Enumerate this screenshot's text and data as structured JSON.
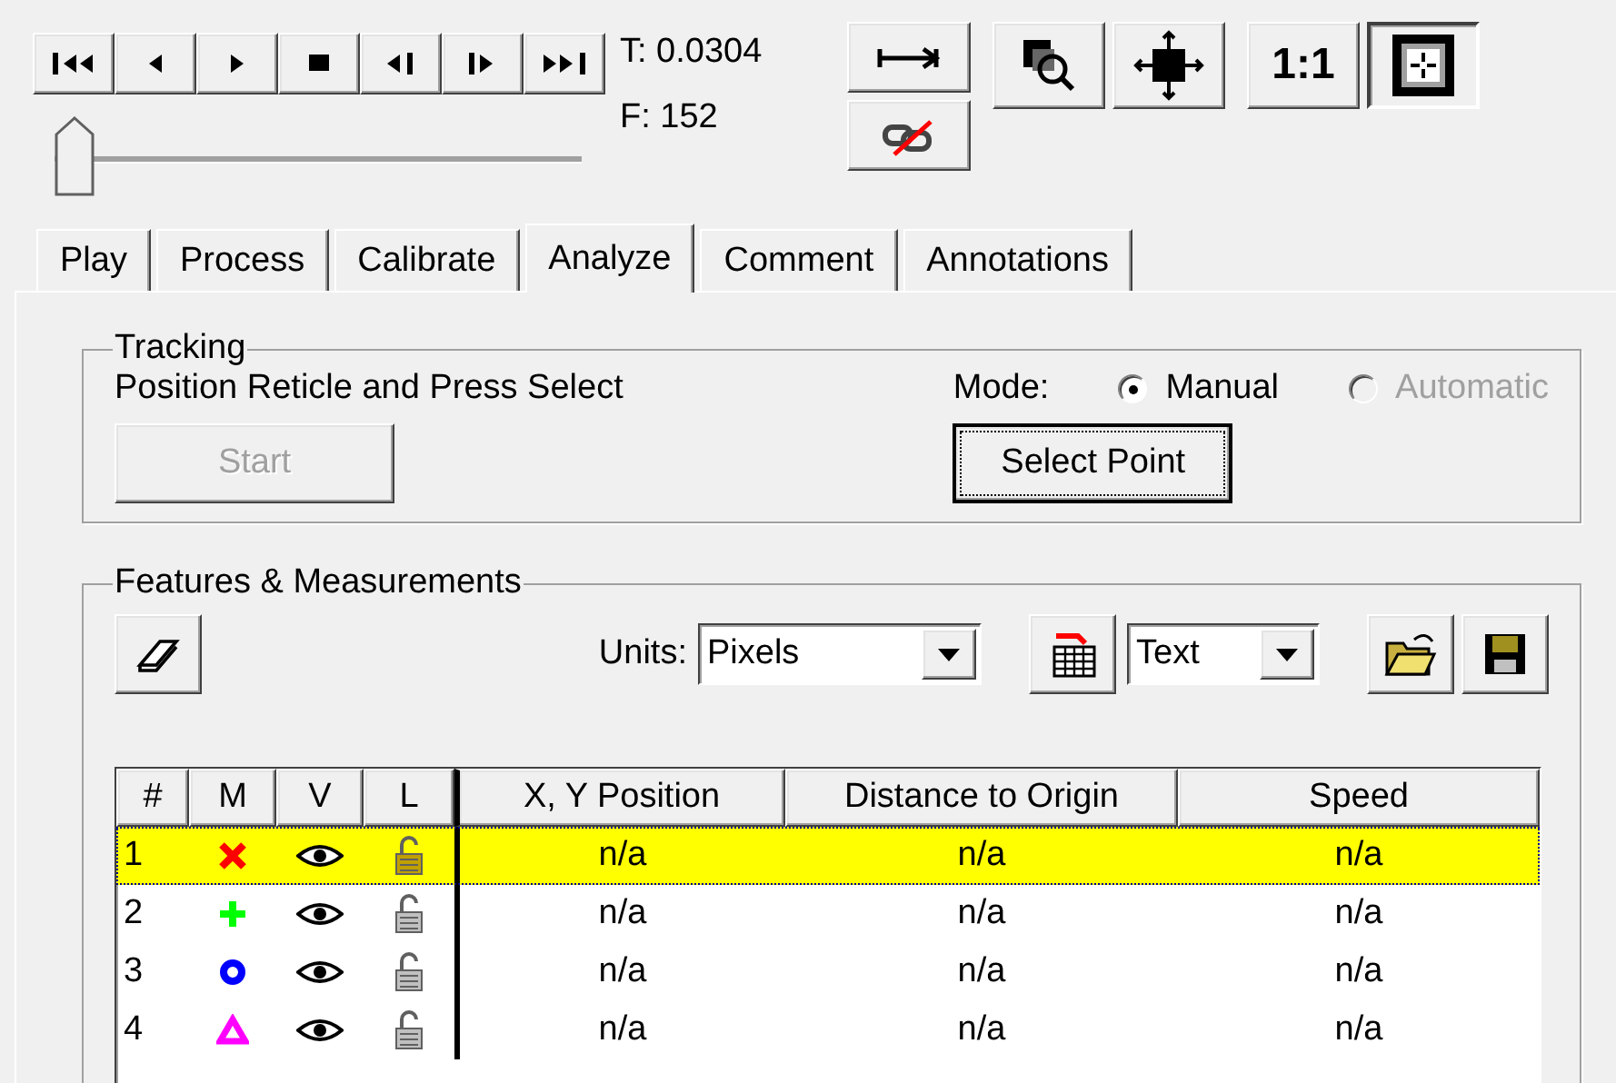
{
  "transport": [
    {
      "kind": "first"
    },
    {
      "kind": "back"
    },
    {
      "kind": "play"
    },
    {
      "kind": "stop"
    },
    {
      "kind": "step-back"
    },
    {
      "kind": "step-forward"
    },
    {
      "kind": "last"
    }
  ],
  "time": "T: 0.0304",
  "frame": "F: 152",
  "slider": {
    "level": 0
  },
  "view_buttons": [
    {
      "kind": "span",
      "pressed": false
    },
    {
      "kind": "unlink",
      "pressed": false
    },
    {
      "kind": "zoom",
      "pressed": false
    },
    {
      "kind": "move",
      "pressed": false
    },
    {
      "kind": "text",
      "label": "1:1",
      "pressed": false
    },
    {
      "kind": "fit",
      "pressed": true
    }
  ],
  "tabs": [
    {
      "label": "Play",
      "selected": false
    },
    {
      "label": "Process",
      "selected": false
    },
    {
      "label": "Calibrate",
      "selected": false
    },
    {
      "label": "Analyze",
      "selected": true
    },
    {
      "label": "Comment",
      "selected": false
    },
    {
      "label": "Annotations",
      "selected": false
    }
  ],
  "tracking": {
    "legend": "Tracking",
    "instruction": "Position Reticle and Press Select",
    "start": {
      "label": "Start",
      "disabled": true
    },
    "mode_label": "Mode:",
    "modes": [
      {
        "label": "Manual",
        "selected": true,
        "disabled": false
      },
      {
        "label": "Automatic",
        "selected": false,
        "disabled": true
      }
    ],
    "select_button": {
      "label": "Select Point",
      "focused": true
    }
  },
  "features": {
    "legend": "Features & Measurements",
    "units_label": "Units:",
    "units": "Pixels",
    "format": "Text",
    "columns": [
      "#",
      "M",
      "V",
      "L",
      "X, Y Position",
      "Distance to Origin",
      "Speed"
    ],
    "rows": [
      {
        "number": "1",
        "kind": "x",
        "color": "#ff0000",
        "selected": true,
        "position": "n/a",
        "distance": "n/a",
        "speed": "n/a"
      },
      {
        "number": "2",
        "kind": "plus",
        "color": "#00ff00",
        "selected": false,
        "position": "n/a",
        "distance": "n/a",
        "speed": "n/a"
      },
      {
        "number": "3",
        "kind": "circle",
        "color": "#0000ff",
        "selected": false,
        "position": "n/a",
        "distance": "n/a",
        "speed": "n/a"
      },
      {
        "number": "4",
        "kind": "triangle",
        "color": "#ff00ff",
        "selected": false,
        "position": "n/a",
        "distance": "n/a",
        "speed": "n/a"
      }
    ]
  }
}
